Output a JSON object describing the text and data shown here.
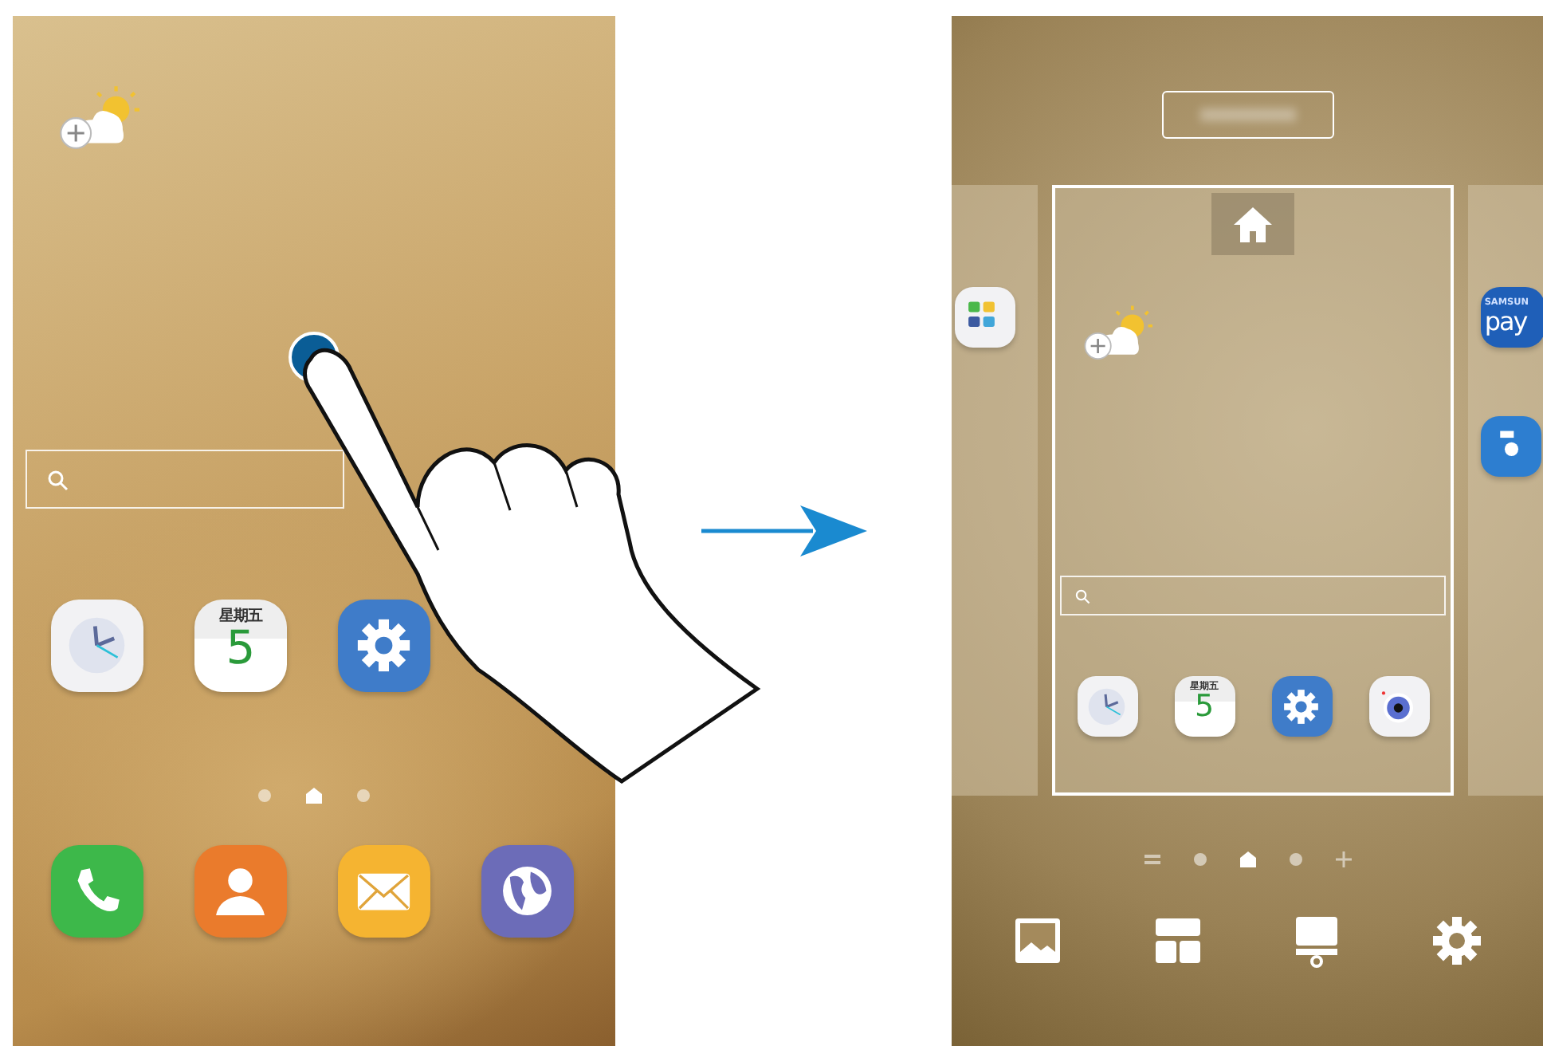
{
  "home_screen": {
    "apps": [
      {
        "kind": "clock"
      },
      {
        "kind": "calendar",
        "weekday": "星期五",
        "day": "5"
      },
      {
        "kind": "settings"
      }
    ],
    "page_indicators": [
      {
        "kind": "dot",
        "selected": false
      },
      {
        "kind": "home",
        "selected": true
      },
      {
        "kind": "dot",
        "selected": false
      }
    ],
    "dock": [
      {
        "kind": "phone"
      },
      {
        "kind": "contacts"
      },
      {
        "kind": "email"
      },
      {
        "kind": "browser"
      }
    ]
  },
  "edit_screen": {
    "left_panel_apps": [
      {
        "kind": "folder"
      }
    ],
    "right_panel_apps": [
      {
        "kind": "pay",
        "brand": "SAMSUN",
        "label": "pay"
      },
      {
        "kind": "storage"
      }
    ],
    "apps": [
      {
        "kind": "clock"
      },
      {
        "kind": "calendar",
        "weekday": "星期五",
        "day": "5"
      },
      {
        "kind": "settings"
      },
      {
        "kind": "camera"
      }
    ],
    "page_indicators": [
      {
        "kind": "pages",
        "selected": false
      },
      {
        "kind": "dot",
        "selected": false
      },
      {
        "kind": "home",
        "selected": true
      },
      {
        "kind": "dot",
        "selected": false
      },
      {
        "kind": "plus",
        "selected": false
      }
    ],
    "toolbar": [
      {
        "kind": "wallpaper"
      },
      {
        "kind": "widgets"
      },
      {
        "kind": "themes"
      },
      {
        "kind": "settings"
      }
    ]
  }
}
